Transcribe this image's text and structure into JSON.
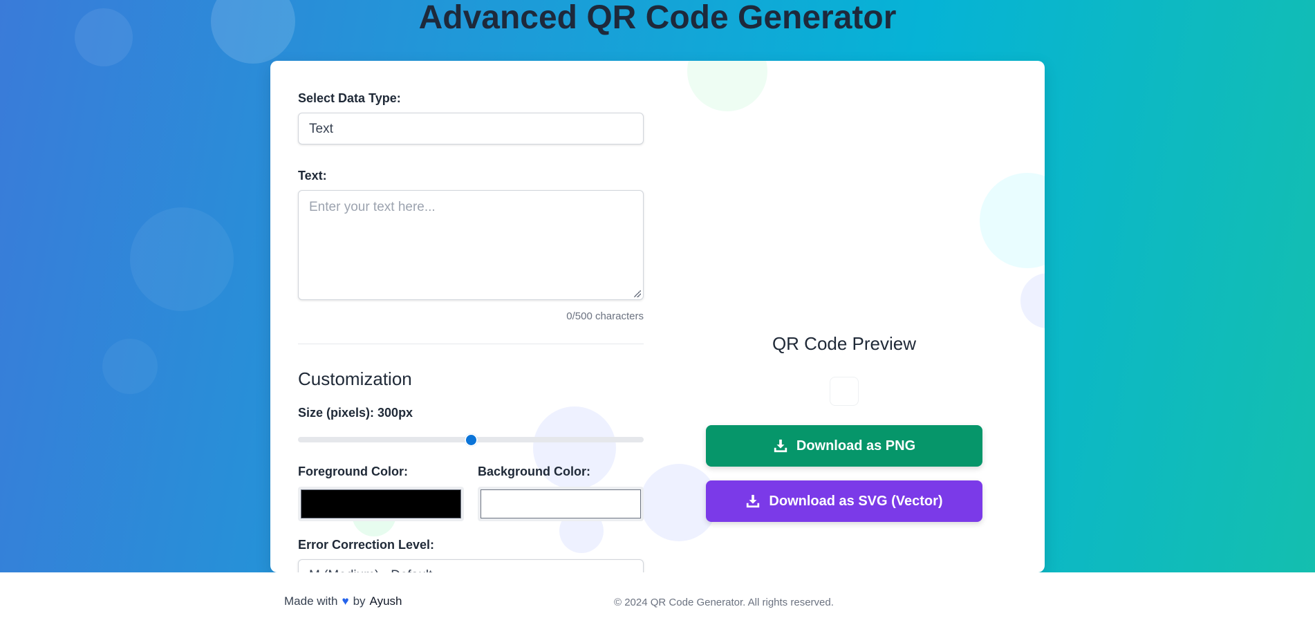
{
  "header": {
    "title": "Advanced QR Code Generator"
  },
  "form": {
    "data_type_label": "Select Data Type:",
    "data_type_value": "Text",
    "text_label": "Text:",
    "text_placeholder": "Enter your text here...",
    "char_count": "0/500 characters"
  },
  "customization": {
    "heading": "Customization",
    "size_label": "Size (pixels): 300px",
    "size_fraction": 0.5,
    "foreground_label": "Foreground Color:",
    "foreground_color": "#000000",
    "background_label": "Background Color:",
    "background_color": "#ffffff",
    "error_label": "Error Correction Level:",
    "error_value": "M (Medium) - Default"
  },
  "preview": {
    "title": "QR Code Preview",
    "download_png_label": "Download as PNG",
    "download_svg_label": "Download as SVG (Vector)",
    "download_icon": "download-icon"
  },
  "colors": {
    "png_button": "#06966a",
    "svg_button": "#7b3ae8",
    "slider_thumb": "#0b74d8"
  },
  "footer": {
    "made_with": "Made with",
    "heart_icon": "heart-icon",
    "by": "by",
    "author": "Ayush",
    "copyright": "© 2024 QR Code Generator. All rights reserved."
  }
}
